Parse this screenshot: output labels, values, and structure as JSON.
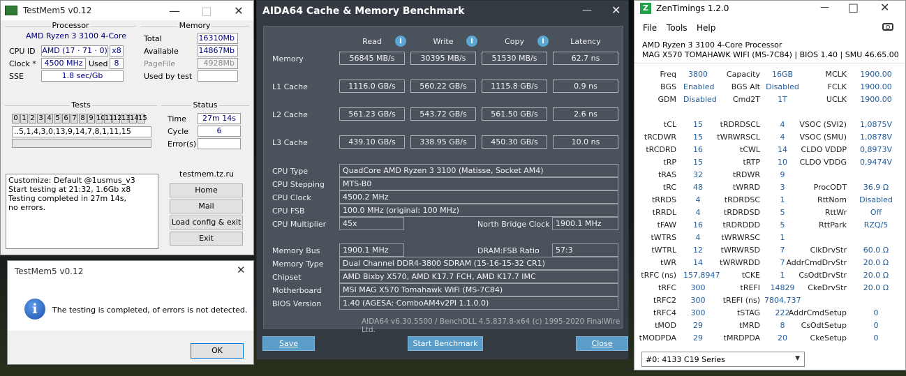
{
  "testmem": {
    "title": "TestMem5 v0.12",
    "processor": {
      "section": "Processor",
      "name": "AMD Ryzen 3 3100 4-Core",
      "cpu_id_label": "CPU ID",
      "cpu_id": "AMD  (17 · 71 · 0)",
      "cpu_threads": "x8",
      "clock_label": "Clock *",
      "clock": "4500 MHz",
      "used_label": "Used",
      "used": "8",
      "sse_label": "SSE",
      "sse": "1.8 sec/Gb"
    },
    "memory": {
      "section": "Memory",
      "total_label": "Total",
      "total": "16310Mb",
      "available_label": "Available",
      "available": "14867Mb",
      "pagefile_label": "PageFile",
      "pagefile": "4928Mb",
      "usedby_label": "Used by test",
      "usedby": ""
    },
    "tests": {
      "section": "Tests",
      "cells": [
        "0",
        "1",
        "2",
        "3",
        "4",
        "5",
        "6",
        "7",
        "8",
        "9",
        "10",
        "11",
        "12",
        "13",
        "14",
        "15"
      ],
      "sequence": "..5,1,4,3,0,13,9,14,7,8,1,11,15"
    },
    "status": {
      "section": "Status",
      "time_label": "Time",
      "time": "27m 14s",
      "cycle_label": "Cycle",
      "cycle": "6",
      "errors_label": "Error(s)",
      "errors": ""
    },
    "log": [
      "Customize: Default @1usmus_v3",
      "Start testing at 21:32, 1.6Gb x8",
      "Testing completed in 27m 14s,",
      "no errors."
    ],
    "site": {
      "section": "testmem.tz.ru",
      "home": "Home",
      "mail": "Mail",
      "load": "Load config & exit",
      "exit": "Exit"
    }
  },
  "dialog": {
    "title": "TestMem5 v0.12",
    "message": "The testing is completed, of errors is not detected.",
    "ok": "OK"
  },
  "aida": {
    "title": "AIDA64 Cache & Memory Benchmark",
    "columns": [
      "Read",
      "Write",
      "Copy",
      "Latency"
    ],
    "rows": [
      {
        "label": "Memory",
        "values": [
          "56845 MB/s",
          "30395 MB/s",
          "51530 MB/s",
          "62.7 ns"
        ]
      },
      {
        "label": "L1 Cache",
        "values": [
          "1116.0 GB/s",
          "560.22 GB/s",
          "1115.8 GB/s",
          "0.9 ns"
        ]
      },
      {
        "label": "L2 Cache",
        "values": [
          "561.23 GB/s",
          "543.72 GB/s",
          "561.50 GB/s",
          "2.6 ns"
        ]
      },
      {
        "label": "L3 Cache",
        "values": [
          "439.10 GB/s",
          "338.95 GB/s",
          "450.30 GB/s",
          "10.0 ns"
        ]
      }
    ],
    "cpu_type_label": "CPU Type",
    "cpu_type": "QuadCore AMD Ryzen 3 3100  (Matisse, Socket AM4)",
    "cpu_stepping_label": "CPU Stepping",
    "cpu_stepping": "MTS-B0",
    "cpu_clock_label": "CPU Clock",
    "cpu_clock": "4500.2 MHz",
    "cpu_fsb_label": "CPU FSB",
    "cpu_fsb": "100.0 MHz  (original: 100 MHz)",
    "cpu_mult_label": "CPU Multiplier",
    "cpu_mult": "45x",
    "nb_clock_label": "North Bridge Clock",
    "nb_clock": "1900.1 MHz",
    "mem_bus_label": "Memory Bus",
    "mem_bus": "1900.1 MHz",
    "dram_ratio_label": "DRAM:FSB Ratio",
    "dram_ratio": "57:3",
    "mem_type_label": "Memory Type",
    "mem_type": "Dual Channel DDR4-3800 SDRAM  (15-16-15-32 CR1)",
    "chipset_label": "Chipset",
    "chipset": "AMD Bixby X570, AMD K17.7 FCH, AMD K17.7 IMC",
    "mobo_label": "Motherboard",
    "mobo": "MSI MAG X570 Tomahawk WiFi (MS-7C84)",
    "bios_label": "BIOS Version",
    "bios": "1.40  (AGESA: ComboAM4v2PI 1.1.0.0)",
    "footer": "AIDA64 v6.30.5500 / BenchDLL 4.5.837.8-x64  (c) 1995-2020 FinalWire Ltd.",
    "save": "Save",
    "start": "Start Benchmark",
    "close": "Close"
  },
  "zen": {
    "title": "ZenTimings 1.2.0",
    "menu": [
      "File",
      "Tools",
      "Help"
    ],
    "cpu": "AMD Ryzen 3 3100 4-Core Processor",
    "board": "MAG X570 TOMAHAWK WIFI (MS-7C84) | BIOS 1.40 | SMU 46.65.00",
    "top": [
      [
        [
          "Freq",
          "3800"
        ],
        [
          "Capacity",
          "16GB"
        ],
        [
          "MCLK",
          "1900.00"
        ]
      ],
      [
        [
          "BGS",
          "Enabled"
        ],
        [
          "BGS Alt",
          "Disabled"
        ],
        [
          "FCLK",
          "1900.00"
        ]
      ],
      [
        [
          "GDM",
          "Disabled"
        ],
        [
          "Cmd2T",
          "1T"
        ],
        [
          "UCLK",
          "1900.00"
        ]
      ]
    ],
    "timings": [
      [
        [
          "tCL",
          "15"
        ],
        [
          "tRDRDSCL",
          "4"
        ],
        [
          "VSOC (SVI2)",
          "1,0875V"
        ]
      ],
      [
        [
          "tRCDWR",
          "15"
        ],
        [
          "tWRWRSCL",
          "4"
        ],
        [
          "VSOC (SMU)",
          "1,0878V"
        ]
      ],
      [
        [
          "tRCDRD",
          "16"
        ],
        [
          "tCWL",
          "14"
        ],
        [
          "CLDO VDDP",
          "0,8973V"
        ]
      ],
      [
        [
          "tRP",
          "15"
        ],
        [
          "tRTP",
          "10"
        ],
        [
          "CLDO VDDG",
          "0,9474V"
        ]
      ],
      [
        [
          "tRAS",
          "32"
        ],
        [
          "tRDWR",
          "9"
        ],
        [
          "",
          ""
        ]
      ],
      [
        [
          "tRC",
          "48"
        ],
        [
          "tWRRD",
          "3"
        ],
        [
          "ProcODT",
          "36.9 Ω"
        ]
      ],
      [
        [
          "tRRDS",
          "4"
        ],
        [
          "tRDRDSC",
          "1"
        ],
        [
          "RttNom",
          "Disabled"
        ]
      ],
      [
        [
          "tRRDL",
          "4"
        ],
        [
          "tRDRDSD",
          "5"
        ],
        [
          "RttWr",
          "Off"
        ]
      ],
      [
        [
          "tFAW",
          "16"
        ],
        [
          "tRDRDDD",
          "5"
        ],
        [
          "RttPark",
          "RZQ/5"
        ]
      ],
      [
        [
          "tWTRS",
          "4"
        ],
        [
          "tWRWRSC",
          "1"
        ],
        [
          "",
          ""
        ]
      ],
      [
        [
          "tWTRL",
          "12"
        ],
        [
          "tWRWRSD",
          "7"
        ],
        [
          "ClkDrvStr",
          "60.0 Ω"
        ]
      ],
      [
        [
          "tWR",
          "14"
        ],
        [
          "tWRWRDD",
          "7"
        ],
        [
          "AddrCmdDrvStr",
          "20.0 Ω"
        ]
      ],
      [
        [
          "tRFC (ns)",
          "157,8947"
        ],
        [
          "tCKE",
          "1"
        ],
        [
          "CsOdtDrvStr",
          "20.0 Ω"
        ]
      ],
      [
        [
          "tRFC",
          "300"
        ],
        [
          "tREFI",
          "14829"
        ],
        [
          "CkeDrvStr",
          "20.0 Ω"
        ]
      ],
      [
        [
          "tRFC2",
          "300"
        ],
        [
          "tREFI (ns)",
          "7804,737"
        ],
        [
          "",
          ""
        ]
      ],
      [
        [
          "tRFC4",
          "300"
        ],
        [
          "tSTAG",
          "222"
        ],
        [
          "AddrCmdSetup",
          "0"
        ]
      ],
      [
        [
          "tMOD",
          "29"
        ],
        [
          "tMRD",
          "8"
        ],
        [
          "CsOdtSetup",
          "0"
        ]
      ],
      [
        [
          "tMODPDA",
          "29"
        ],
        [
          "tMRDPDA",
          "20"
        ],
        [
          "CkeSetup",
          "0"
        ]
      ]
    ],
    "profile": "#0: 4133 C19 Series"
  },
  "colors": {
    "aida_bg": "#343b43",
    "aida_panel": "#4a525b",
    "aida_button": "#5b9ec9",
    "zen_value": "#1f5c9c",
    "zen_icon": "#1fa34a"
  }
}
